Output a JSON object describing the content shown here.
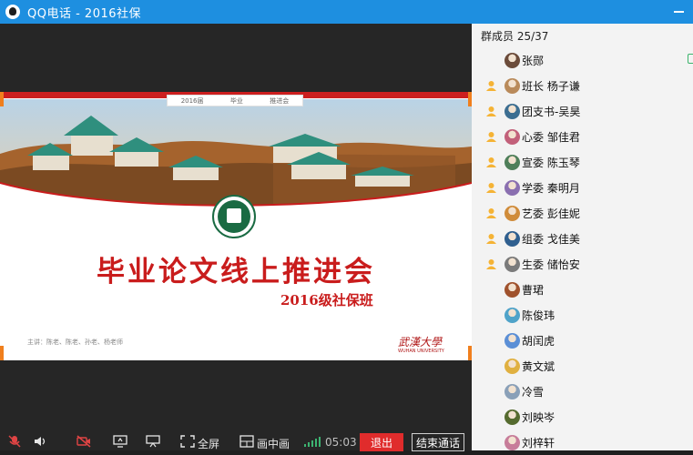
{
  "window": {
    "title": "QQ电话 - 2016社保"
  },
  "slide": {
    "tag_left": "2016届",
    "tag_mid": "毕业",
    "tag_right": "推进会",
    "title": "毕业论文线上推进会",
    "subtitle": "2016级社保班",
    "names": "主讲：陈老、陈老、孙老、杨老师",
    "signature": "武漢大學",
    "signature_sub": "WUHAN UNIVERSITY"
  },
  "controls": {
    "fullscreen": "全屏",
    "pip": "画中画",
    "timer": "05:03",
    "exit": "退出",
    "end_call": "结束通话"
  },
  "panel": {
    "header": "群成员 25/37",
    "members": [
      {
        "name": "张郧",
        "badge": false
      },
      {
        "name": "班长 杨子谦",
        "badge": true
      },
      {
        "name": "团支书-吴昊",
        "badge": true
      },
      {
        "name": "心委 邹佳君",
        "badge": true
      },
      {
        "name": "宣委 陈玉琴",
        "badge": true
      },
      {
        "name": "学委 秦明月",
        "badge": true
      },
      {
        "name": "艺委 彭佳妮",
        "badge": true
      },
      {
        "name": "组委  戈佳美",
        "badge": true
      },
      {
        "name": "生委 储怡安",
        "badge": true
      },
      {
        "name": "曹珺",
        "badge": false
      },
      {
        "name": "陈俊玮",
        "badge": false
      },
      {
        "name": "胡闰虎",
        "badge": false
      },
      {
        "name": "黄文斌",
        "badge": false
      },
      {
        "name": "冷雪",
        "badge": false
      },
      {
        "name": "刘映岑",
        "badge": false
      },
      {
        "name": "刘梓轩",
        "badge": false
      }
    ]
  },
  "colors": {
    "titlebar": "#1e8fe0",
    "accent_red": "#c91c1c",
    "exit_button": "#e02c2c"
  }
}
